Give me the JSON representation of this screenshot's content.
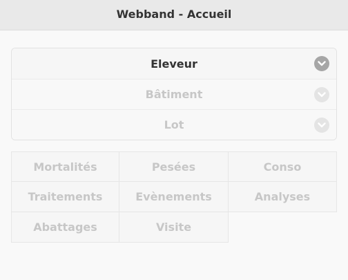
{
  "header": {
    "title": "Webband - Accueil"
  },
  "selectors": [
    {
      "label": "Eleveur",
      "icon": "chevron-down-icon",
      "active": true
    },
    {
      "label": "Bâtiment",
      "icon": "chevron-down-icon",
      "active": false
    },
    {
      "label": "Lot",
      "icon": "chevron-down-icon",
      "active": false
    }
  ],
  "menu": {
    "items": [
      {
        "label": "Mortalités"
      },
      {
        "label": "Pesées"
      },
      {
        "label": "Conso"
      },
      {
        "label": "Traitements"
      },
      {
        "label": "Evènements"
      },
      {
        "label": "Analyses"
      },
      {
        "label": "Abattages"
      },
      {
        "label": "Visite"
      }
    ]
  },
  "colors": {
    "header_bg": "#e9e9e9",
    "text_active": "#333333",
    "text_disabled": "#c7c7c7",
    "chevron_active": "#a6a6a6",
    "chevron_disabled": "#e4e4e4"
  }
}
